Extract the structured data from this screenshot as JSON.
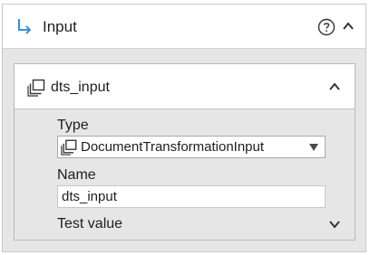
{
  "section": {
    "title": "Input",
    "icons": {
      "title": "input-arrow-icon",
      "help": "help-icon",
      "collapse": "chevron-up-icon"
    },
    "accent_color": "#3a8fd9"
  },
  "input_item": {
    "name": "dts_input",
    "icons": {
      "item": "data-object-icon",
      "collapse": "chevron-up-icon"
    },
    "type": {
      "label": "Type",
      "value": "DocumentTransformationInput",
      "icon": "data-object-icon",
      "dropdown_icon": "dropdown-triangle-icon"
    },
    "name_field": {
      "label": "Name",
      "value": "dts_input"
    },
    "test_value": {
      "label": "Test value",
      "icon": "chevron-down-icon"
    }
  }
}
